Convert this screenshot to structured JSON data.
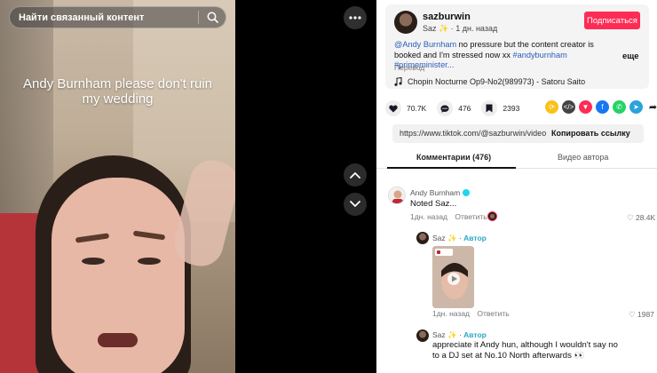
{
  "search": {
    "placeholder": "Найти связанный контент",
    "icon": "search-icon"
  },
  "video": {
    "caption": "Andy Burnham please don't ruin my wedding",
    "more_icon": "more-dots-icon"
  },
  "post": {
    "handle": "sazburwin",
    "display_name": "Saz ✨",
    "time": "1 дн. назад",
    "subscribe_label": "Подписаться",
    "description_parts": [
      {
        "text": "@Andy Burnham",
        "tag": true
      },
      {
        "text": " no pressure but the content creator is booked and I'm stressed now xx ",
        "tag": false
      },
      {
        "text": "#andyburnham",
        "tag": true
      },
      {
        "text": " ",
        "tag": false
      },
      {
        "text": "#primeminister...",
        "tag": true
      }
    ],
    "more_label": "еще",
    "translate_label": "Перевод",
    "music": "Chopin Nocturne Op9-No2(989973) - Satoru Saito"
  },
  "actions": {
    "likes": "70.7K",
    "comments": "476",
    "saves": "2393"
  },
  "link": {
    "url": "https://www.tiktok.com/@sazburwin/video/...",
    "copy_label": "Копировать ссылку"
  },
  "tabs": {
    "comments": "Комментарии (476)",
    "author_videos": "Видео автора"
  },
  "comments": [
    {
      "name": "Andy Burnham",
      "verified": true,
      "text": "Noted Saz...",
      "time": "1дн. назад",
      "reply": "Ответить",
      "likes": "28.4K"
    },
    {
      "name": "Saz ✨",
      "author_label": "Автор",
      "time": "1дн. назад",
      "reply": "Ответить",
      "likes": "1987"
    },
    {
      "name": "Saz ✨",
      "author_label": "Автор",
      "text": "appreciate it Andy hun, although I wouldn't say no to a DJ set at No.10 North afterwards 👀"
    }
  ],
  "colors": {
    "accent": "#fe2c55",
    "link": "#2b5db9",
    "author": "#2aa8c4"
  }
}
